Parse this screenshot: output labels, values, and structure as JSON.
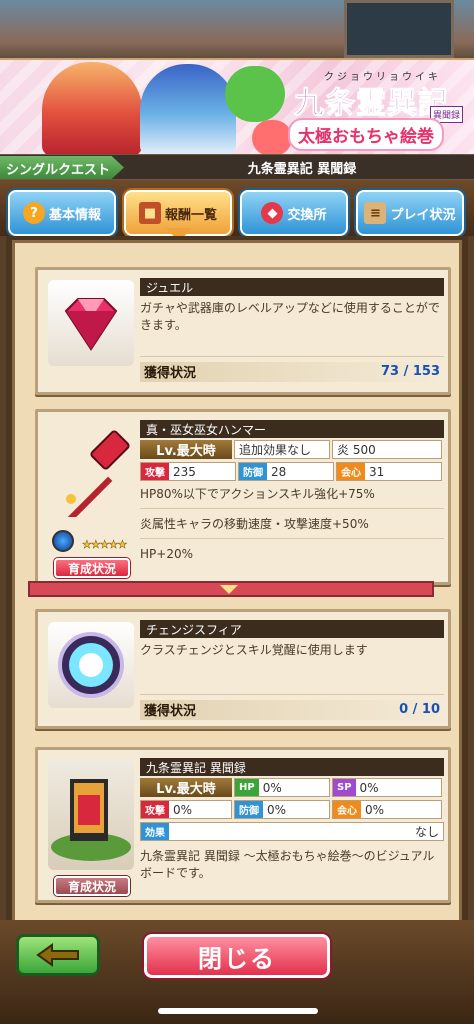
{
  "header": {
    "logo_title": "九条霊異記",
    "logo_ruby": "クジョウリョウイキ",
    "logo_subtitle": "太極おもちゃ絵巻",
    "logo_tag": "異聞録",
    "mode_label": "シングルクエスト",
    "quest_title": "九条霊異記 異聞録"
  },
  "tabs": [
    {
      "label": "基本情報",
      "icon": "question-icon",
      "active": false
    },
    {
      "label": "報酬一覧",
      "icon": "treasure-chest-icon",
      "active": true
    },
    {
      "label": "交換所",
      "icon": "exchange-bag-icon",
      "active": false
    },
    {
      "label": "プレイ状況",
      "icon": "scroll-icon",
      "active": false
    }
  ],
  "rewards": [
    {
      "name": "ジュエル",
      "description": "ガチャや武器庫のレベルアップなどに使用することができます。",
      "status_label": "獲得状況",
      "count": "73 / 153",
      "icon": "jewel-icon"
    },
    {
      "name": "真・巫女巫女ハンマー",
      "level_label": "Lv.最大時",
      "extra_effect": "追加効果なし",
      "element_value": "炎 500",
      "atk_label": "攻撃",
      "atk": "235",
      "def_label": "防御",
      "def": "28",
      "crit_label": "会心",
      "crit": "31",
      "effects": [
        "HP80%以下でアクションスキル強化+75%",
        "炎属性キャラの移動速度・攻撃速度+50%",
        "HP+20%"
      ],
      "rarity": "★★★★★",
      "button": "育成状況",
      "icon": "hammer-icon"
    },
    {
      "name": "チェンジスフィア",
      "description": "クラスチェンジとスキル覚醒に使用します",
      "status_label": "獲得状況",
      "count": "0 / 10",
      "icon": "sphere-icon"
    },
    {
      "name": "九条霊異記 異聞録",
      "level_label": "Lv.最大時",
      "hp_label": "HP",
      "hp": "0%",
      "sp_label": "SP",
      "sp": "0%",
      "atk_label": "攻撃",
      "atk": "0%",
      "def_label": "防御",
      "def": "0%",
      "crit_label": "会心",
      "crit": "0%",
      "effect_label": "効果",
      "effect_value": "なし",
      "description": "九条霊異記 異聞録 〜太極おもちゃ絵巻〜のビジュアルボードです。",
      "button": "育成状況",
      "icon": "visual-board-icon"
    }
  ],
  "footer": {
    "back_icon": "back-arrow-icon",
    "close_label": "閉じる"
  },
  "colors": {
    "atk": "#d8283e",
    "def": "#2f93d6",
    "crit": "#f08a1a",
    "hp": "#3aa63a",
    "sp": "#a04ad0",
    "count": "#1a4fb3"
  }
}
